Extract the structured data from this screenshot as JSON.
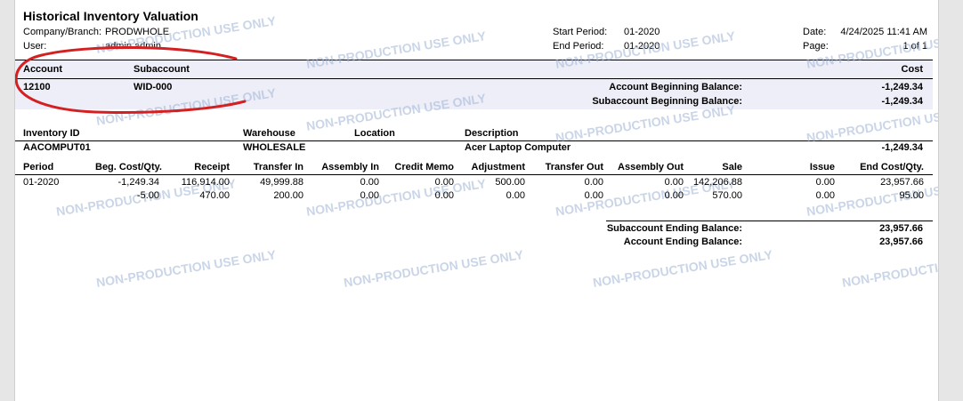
{
  "report": {
    "title": "Historical Inventory Valuation",
    "company_label": "Company/Branch:",
    "company_value": "PRODWHOLE",
    "user_label": "User:",
    "user_value": "admin admin",
    "start_period_label": "Start Period:",
    "start_period_value": "01-2020",
    "end_period_label": "End Period:",
    "end_period_value": "01-2020",
    "date_label": "Date:",
    "date_value": "4/24/2025 11:41 AM",
    "page_label": "Page:",
    "page_value": "1 of 1"
  },
  "account_header": {
    "account": "Account",
    "subaccount": "Subaccount",
    "cost": "Cost"
  },
  "account_row": {
    "account": "12100",
    "subaccount": "WID-000",
    "acct_beg_label": "Account Beginning Balance:",
    "acct_beg_value": "-1,249.34",
    "sub_beg_label": "Subaccount Beginning Balance:",
    "sub_beg_value": "-1,249.34"
  },
  "item_header": {
    "inventory_id": "Inventory ID",
    "warehouse": "Warehouse",
    "location": "Location",
    "description": "Description"
  },
  "item_row": {
    "inventory_id": "AACOMPUT01",
    "warehouse": "WHOLESALE",
    "description": "Acer Laptop Computer",
    "cost": "-1,249.34"
  },
  "period_columns": [
    "Period",
    "Beg. Cost/Qty.",
    "Receipt",
    "Transfer In",
    "Assembly In",
    "Credit Memo",
    "Adjustment",
    "Transfer Out",
    "Assembly Out",
    "Sale",
    "Issue",
    "End Cost/Qty."
  ],
  "period_rows": [
    [
      "01-2020",
      "-1,249.34",
      "116,914.00",
      "49,999.88",
      "0.00",
      "0.00",
      "500.00",
      "0.00",
      "0.00",
      "142,206.88",
      "0.00",
      "23,957.66"
    ],
    [
      "",
      "-5.00",
      "470.00",
      "200.00",
      "0.00",
      "0.00",
      "0.00",
      "0.00",
      "0.00",
      "570.00",
      "0.00",
      "95.00"
    ]
  ],
  "ending": {
    "sub_end_label": "Subaccount Ending Balance:",
    "sub_end_value": "23,957.66",
    "acct_end_label": "Account Ending Balance:",
    "acct_end_value": "23,957.66"
  },
  "watermark": "NON-PRODUCTION USE ONLY",
  "colors": {
    "annotation_red": "#d42020",
    "band": "#eeeef8",
    "watermark": "#9fb4d4"
  }
}
